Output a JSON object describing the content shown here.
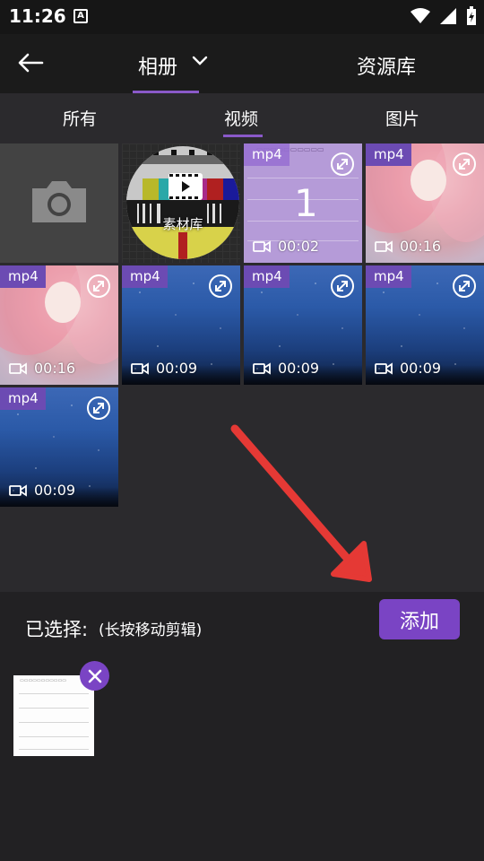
{
  "status_bar": {
    "time": "11:26",
    "notification_icon": "A"
  },
  "header": {
    "album_label": "相册",
    "library_label": "资源库"
  },
  "filters": {
    "all": "所有",
    "video": "视频",
    "image": "图片"
  },
  "grid": {
    "library_label": "素材库",
    "items": [
      {
        "format": "mp4",
        "duration": "00:02",
        "thumb": "doc"
      },
      {
        "format": "mp4",
        "duration": "00:16",
        "thumb": "anime"
      },
      {
        "format": "mp4",
        "duration": "00:16",
        "thumb": "anime"
      },
      {
        "format": "mp4",
        "duration": "00:09",
        "thumb": "space"
      },
      {
        "format": "mp4",
        "duration": "00:09",
        "thumb": "space"
      },
      {
        "format": "mp4",
        "duration": "00:09",
        "thumb": "space"
      },
      {
        "format": "mp4",
        "duration": "00:09",
        "thumb": "space"
      }
    ],
    "doc_thumb_number": "1"
  },
  "selection": {
    "label": "已选择:",
    "hint": "(长按移动剪辑)",
    "add_button": "添加"
  },
  "colors": {
    "accent": "#7a44c4",
    "underline": "#8a59c9",
    "arrow": "#e53935"
  }
}
